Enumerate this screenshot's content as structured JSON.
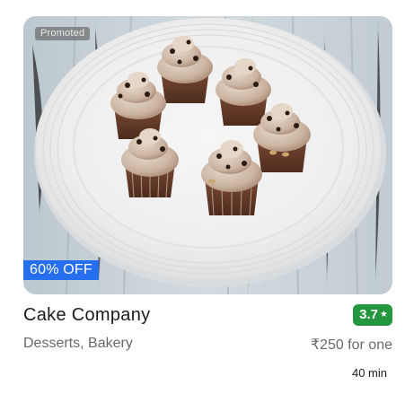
{
  "card": {
    "promoted_label": "Promoted",
    "discount_label": "60% OFF",
    "restaurant_name": "Cake Company",
    "rating": "3.7",
    "rating_icon": "star-icon",
    "cuisines": "Desserts, Bakery",
    "price_for_one": "₹250 for one",
    "delivery_time": "40 min"
  },
  "colors": {
    "discount_bg": "#256fef",
    "rating_bg": "#24963f",
    "promoted_bg": "#6e6e6e"
  }
}
